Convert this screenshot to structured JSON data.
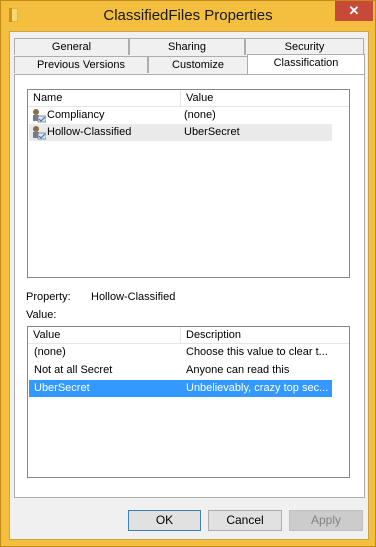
{
  "window": {
    "title": "ClassifiedFiles Properties",
    "close_glyph": "✕",
    "accent_color": "#f4bf3f"
  },
  "tabs": {
    "back_row": [
      "General",
      "Sharing",
      "Security"
    ],
    "front_row": [
      "Previous Versions",
      "Customize",
      "Classification"
    ],
    "active": "Classification"
  },
  "properties_list": {
    "columns": [
      "Name",
      "Value"
    ],
    "rows": [
      {
        "name": "Compliancy",
        "value": "(none)",
        "icon": "property-icon"
      },
      {
        "name": "Hollow-Classified",
        "value": "UberSecret",
        "icon": "property-icon"
      }
    ]
  },
  "property": {
    "label": "Property:",
    "value": "Hollow-Classified"
  },
  "value_label": "Value:",
  "values_list": {
    "columns": [
      "Value",
      "Description"
    ],
    "rows": [
      {
        "value": "(none)",
        "description": "Choose this value to clear t..."
      },
      {
        "value": "Not at all Secret",
        "description": "Anyone can read this"
      },
      {
        "value": "UberSecret",
        "description": "Unbelievably, crazy top sec..."
      }
    ]
  },
  "buttons": {
    "ok": "OK",
    "cancel": "Cancel",
    "apply": "Apply"
  }
}
